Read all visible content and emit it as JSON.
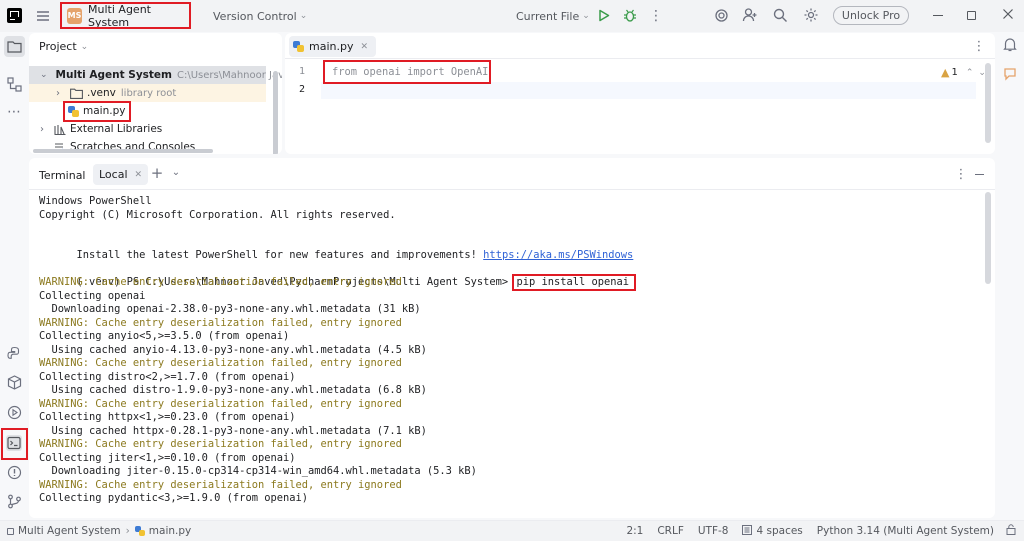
{
  "title_bar": {
    "app_icon": "pycharm-icon",
    "menu_icon": "hamburger-menu-icon",
    "project_badge": "MS",
    "project_name": "Multi Agent System",
    "vcs_label": "Version Control",
    "run_config": "Current File",
    "unlock_label": "Unlock Pro"
  },
  "left_toolbar": {
    "top": [
      "project-folder-icon",
      "structure-icon",
      "more-icon"
    ],
    "bottom": [
      "python-console-icon",
      "python-packages-icon",
      "services-icon",
      "terminal-icon",
      "problems-icon",
      "git-icon"
    ]
  },
  "project_panel": {
    "header": "Project",
    "tree": [
      {
        "name": "Multi Agent System",
        "hint": "C:\\Users\\Mahnoor Javed"
      },
      {
        "name": ".venv",
        "hint": "library root"
      },
      {
        "name": "main.py"
      },
      {
        "name": "External Libraries"
      },
      {
        "name": "Scratches and Consoles"
      }
    ]
  },
  "editor": {
    "tab": "main.py",
    "lines": [
      {
        "number": "1",
        "code": "from openai import OpenAI"
      },
      {
        "number": "2",
        "code": ""
      }
    ],
    "warning_count": "1"
  },
  "terminal": {
    "title": "Terminal",
    "tab": "Local",
    "intro": [
      "Windows PowerShell",
      "Copyright (C) Microsoft Corporation. All rights reserved."
    ],
    "install_text": "Install the latest PowerShell for new features and improvements! ",
    "install_link": "https://aka.ms/PSWindows",
    "prompt": "(.venv) PS C:\\Users\\Mahnoor Javed\\PycharmProjects\\Multi Agent System> ",
    "command": "pip install openai",
    "output": [
      {
        "text": "WARNING: Cache entry deserialization failed, entry ignored",
        "kind": "warn"
      },
      {
        "text": "Collecting openai",
        "kind": "normal"
      },
      {
        "text": "  Downloading openai-2.38.0-py3-none-any.whl.metadata (31 kB)",
        "kind": "normal"
      },
      {
        "text": "WARNING: Cache entry deserialization failed, entry ignored",
        "kind": "warn"
      },
      {
        "text": "Collecting anyio<5,>=3.5.0 (from openai)",
        "kind": "normal"
      },
      {
        "text": "  Using cached anyio-4.13.0-py3-none-any.whl.metadata (4.5 kB)",
        "kind": "normal"
      },
      {
        "text": "WARNING: Cache entry deserialization failed, entry ignored",
        "kind": "warn"
      },
      {
        "text": "Collecting distro<2,>=1.7.0 (from openai)",
        "kind": "normal"
      },
      {
        "text": "  Using cached distro-1.9.0-py3-none-any.whl.metadata (6.8 kB)",
        "kind": "normal"
      },
      {
        "text": "WARNING: Cache entry deserialization failed, entry ignored",
        "kind": "warn"
      },
      {
        "text": "Collecting httpx<1,>=0.23.0 (from openai)",
        "kind": "normal"
      },
      {
        "text": "  Using cached httpx-0.28.1-py3-none-any.whl.metadata (7.1 kB)",
        "kind": "normal"
      },
      {
        "text": "WARNING: Cache entry deserialization failed, entry ignored",
        "kind": "warn"
      },
      {
        "text": "Collecting jiter<1,>=0.10.0 (from openai)",
        "kind": "normal"
      },
      {
        "text": "  Downloading jiter-0.15.0-cp314-cp314-win_amd64.whl.metadata (5.3 kB)",
        "kind": "normal"
      },
      {
        "text": "WARNING: Cache entry deserialization failed, entry ignored",
        "kind": "warn"
      },
      {
        "text": "Collecting pydantic<3,>=1.9.0 (from openai)",
        "kind": "normal"
      }
    ]
  },
  "status_bar": {
    "breadcrumb": [
      "Multi Agent System",
      "main.py"
    ],
    "position": "2:1",
    "line_ending": "CRLF",
    "encoding": "UTF-8",
    "indent": "4 spaces",
    "interpreter": "Python 3.14 (Multi Agent System)"
  },
  "colors": {
    "highlight": "#e01b24",
    "warning": "#8c7a1f",
    "link": "#2f62d6",
    "accent": "#3574f0"
  }
}
